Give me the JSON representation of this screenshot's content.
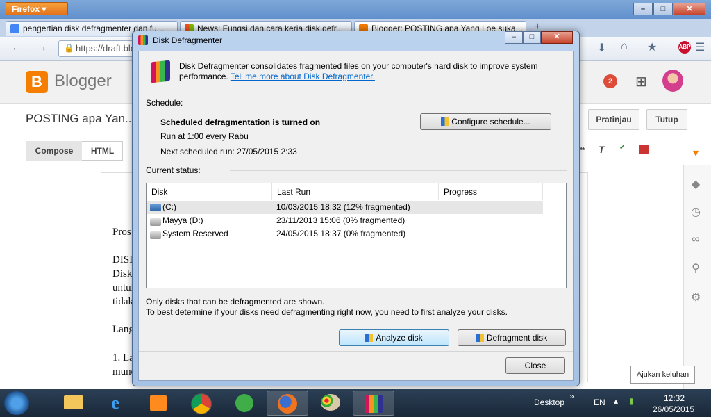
{
  "firefox": {
    "menu_label": "Firefox",
    "tabs": [
      {
        "label": "pengertian disk defragmenter dan fu...",
        "color": "#4285f4"
      },
      {
        "label": "News: Fungsi dan cara kerja disk defr...",
        "color": "#7cbb00"
      },
      {
        "label": "Blogger: POSTING apa Yang Loe suka...",
        "color": "#f57d00"
      }
    ],
    "new_tab": "+",
    "url": "https://draft.blo",
    "minimize": "–",
    "maximize": "□",
    "close": "✕"
  },
  "blogger": {
    "logo_letter": "B",
    "name": "Blogger",
    "notification_count": "2",
    "post_title": "POSTING apa Yan...",
    "preview_label": "Pratinjau",
    "close_label": "Tutup",
    "compose_tab": "Compose",
    "html_tab": "HTML",
    "editor_lines": [
      "Pros",
      "DISI",
      "Disk",
      "untuk",
      "tidak",
      "Lang",
      "1. La",
      "mund"
    ],
    "feedback_tooltip": "Ajukan keluhan"
  },
  "dialog": {
    "title": "Disk Defragmenter",
    "intro_text": "Disk Defragmenter consolidates fragmented files on your computer's hard disk to improve system",
    "intro_text2": "performance.",
    "intro_link": "Tell me more about Disk Defragmenter.",
    "schedule_header": "Schedule:",
    "schedule_status": "Scheduled defragmentation is turned on",
    "schedule_run": "Run at 1:00 every Rabu",
    "schedule_next": "Next scheduled run: 27/05/2015 2:33",
    "configure_button": "Configure schedule...",
    "current_status_header": "Current status:",
    "columns": [
      "Disk",
      "Last Run",
      "Progress"
    ],
    "disks": [
      {
        "name": "(C:)",
        "last_run": "10/03/2015 18:32 (12% fragmented)",
        "progress": ""
      },
      {
        "name": "Mayya (D:)",
        "last_run": "23/11/2013 15:06 (0% fragmented)",
        "progress": ""
      },
      {
        "name": "System Reserved",
        "last_run": "24/05/2015 18:37 (0% fragmented)",
        "progress": ""
      }
    ],
    "note1": "Only disks that can be defragmented are shown.",
    "note2": "To best determine if your disks need defragmenting right now, you need to first analyze your disks.",
    "analyze_button": "Analyze disk",
    "defragment_button": "Defragment disk",
    "close_button": "Close"
  },
  "taskbar": {
    "desktop_label": "Desktop",
    "chevron": "»",
    "language": "EN",
    "time": "12:32",
    "date": "26/05/2015"
  },
  "colors": {
    "accent_blue": "#3c7fb1",
    "blogger_orange": "#f57d00",
    "link": "#0066cc"
  }
}
